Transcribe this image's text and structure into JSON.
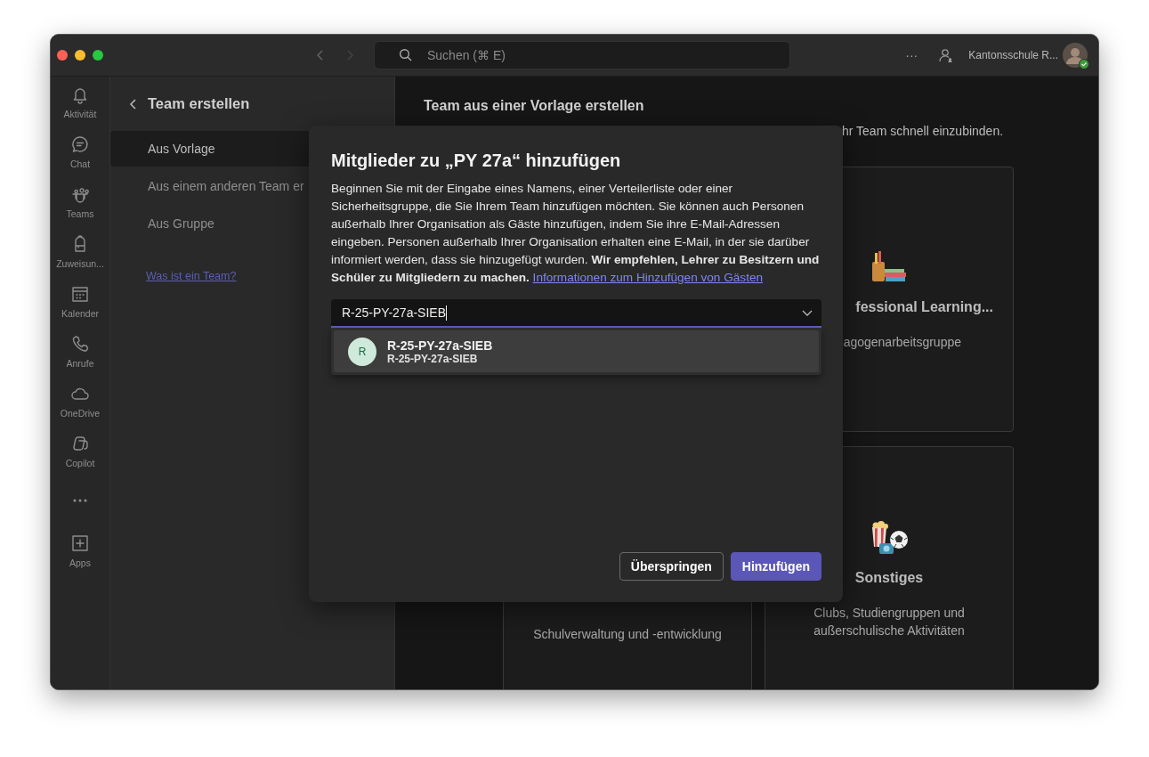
{
  "titlebar": {
    "search": {
      "placeholder": "Suchen (⌘ E)"
    },
    "more": "···",
    "account": "Kantonsschule R...",
    "online": true
  },
  "rail": [
    {
      "kind": "bell",
      "label": "Aktivität"
    },
    {
      "kind": "chat",
      "label": "Chat"
    },
    {
      "kind": "teams",
      "label": "Teams"
    },
    {
      "kind": "backpack",
      "label": "Zuweisun..."
    },
    {
      "kind": "calendar",
      "label": "Kalender"
    },
    {
      "kind": "phone",
      "label": "Anrufe"
    },
    {
      "kind": "cloud",
      "label": "OneDrive"
    },
    {
      "kind": "copilot",
      "label": "Copilot"
    },
    {
      "kind": "more"
    },
    {
      "kind": "apps",
      "label": "Apps"
    }
  ],
  "panel": {
    "title": "Team erstellen",
    "items": [
      {
        "label": "Aus Vorlage",
        "selected": true
      },
      {
        "label": "Aus einem anderen Team er",
        "selected": false
      },
      {
        "label": "Aus Gruppe",
        "selected": false
      }
    ],
    "link": "Was ist ein Team?"
  },
  "main": {
    "heading": "Team aus einer Vorlage erstellen",
    "subtitle": "hr Team schnell einzubinden.",
    "cards": [
      {
        "kind": "books",
        "title": "fessional Learning...",
        "description": "agogenarbeitsgruppe"
      },
      {
        "description": "Schulverwaltung und -entwicklung"
      },
      {
        "kind": "popcorn",
        "title": "Sonstiges",
        "description": "Clubs, Studiengruppen und außerschulische Aktivitäten"
      }
    ]
  },
  "dialog": {
    "title": "Mitglieder zu „PY 27a“ hinzufügen",
    "description": "Beginnen Sie mit der Eingabe eines Namens, einer Verteilerliste oder einer Sicherheitsgruppe, die Sie Ihrem Team hinzufügen möchten. Sie können auch Personen außerhalb Ihrer Organisation als Gäste hinzufügen, indem Sie ihre E-Mail-Adressen eingeben. Personen außerhalb Ihrer Organisation erhalten eine E-Mail, in der sie darüber informiert werden, dass sie hinzugefügt wurden. **Wir empfehlen, Lehrer zu Besitzern und Schüler zu Mitgliedern zu machen.**",
    "link": "Informationen zum Hinzufügen von Gästen",
    "input": {
      "value": "R-25-PY-27a-SIEB"
    },
    "suggestions": [
      {
        "initial": "R",
        "name": "R-25-PY-27a-SIEB",
        "detail": "R-25-PY-27a-SIEB",
        "selected": true
      }
    ],
    "buttons": [
      {
        "kind": "secondary",
        "label": "Überspringen"
      },
      {
        "kind": "primary",
        "label": "Hinzufügen"
      }
    ]
  }
}
